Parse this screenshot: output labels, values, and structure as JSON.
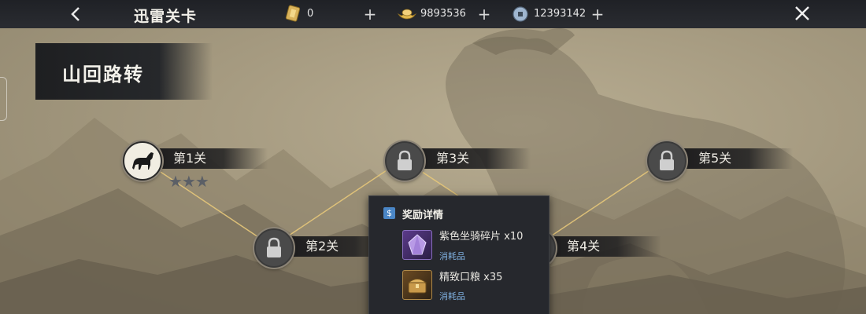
{
  "topbar": {
    "title": "迅雷关卡",
    "resources": [
      {
        "icon": "gold-ticket-icon",
        "value": "0"
      },
      {
        "icon": "gold-ingot-icon",
        "value": "9893536"
      },
      {
        "icon": "coin-icon",
        "value": "12393142"
      }
    ]
  },
  "chapter": {
    "title": "山回路转"
  },
  "levels": [
    {
      "label": "第1关",
      "status": "unlocked",
      "stars_earned": 0,
      "stars_total": 3
    },
    {
      "label": "第2关",
      "status": "locked"
    },
    {
      "label": "第3关",
      "status": "locked"
    },
    {
      "label": "第4关",
      "status": "locked"
    },
    {
      "label": "第5关",
      "status": "locked"
    }
  ],
  "reward_popup": {
    "title": "奖励详情",
    "items": [
      {
        "name": "紫色坐骑碎片 x10",
        "type": "消耗品",
        "icon": "purple-mount-shard-icon"
      },
      {
        "name": "精致口粮 x35",
        "type": "消耗品",
        "icon": "ration-chest-icon"
      }
    ]
  },
  "colors": {
    "topbar": "#24262b",
    "banner": "#1e1f21",
    "path_line": "#e6c77a",
    "item_type": "#7fb0e0"
  }
}
